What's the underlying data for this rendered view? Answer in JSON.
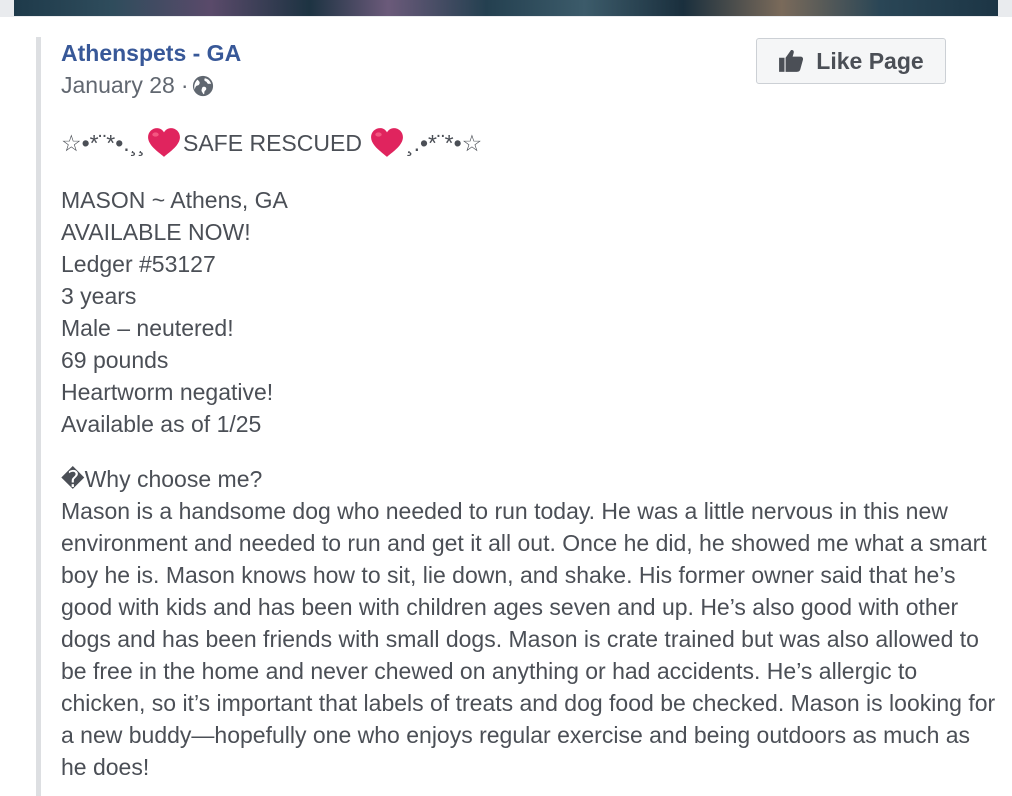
{
  "post": {
    "page_name": "Athenspets - GA",
    "date": "January 28",
    "separator": "·",
    "privacy_icon": "globe-icon",
    "like_button_label": "Like Page",
    "headline": {
      "prefix": "☆•*¨*•.¸¸",
      "text": "SAFE RESCUED",
      "suffix": "¸.•*¨*•☆",
      "heart_color": "#e0245e"
    },
    "details": [
      "MASON ~ Athens, GA",
      "AVAILABLE NOW!",
      "Ledger #53127",
      "3 years",
      "Male – neutered!",
      "69 pounds",
      "Heartworm negative!",
      "Available as of 1/25"
    ],
    "why_heading": "�Why choose me?",
    "description": "Mason is a handsome dog who needed to run today. He was a little nervous in this new environment and needed to run and get it all out. Once he did, he showed me what a smart boy he is. Mason knows how to sit, lie down, and shake. His former owner said that he’s good with kids and has been with children ages seven and up. He’s also good with other dogs and has been friends with small dogs. Mason is crate trained but was also allowed to be free in the home and never chewed on anything or had accidents. He’s allergic to chicken, so it’s important that labels of treats and dog food be checked. Mason is looking for a new buddy—hopefully one who enjoys regular exercise and being outdoors as much as he does!"
  },
  "colors": {
    "link": "#385898",
    "text": "#4b4f56",
    "meta": "#616770",
    "background": "#e9ebee"
  }
}
